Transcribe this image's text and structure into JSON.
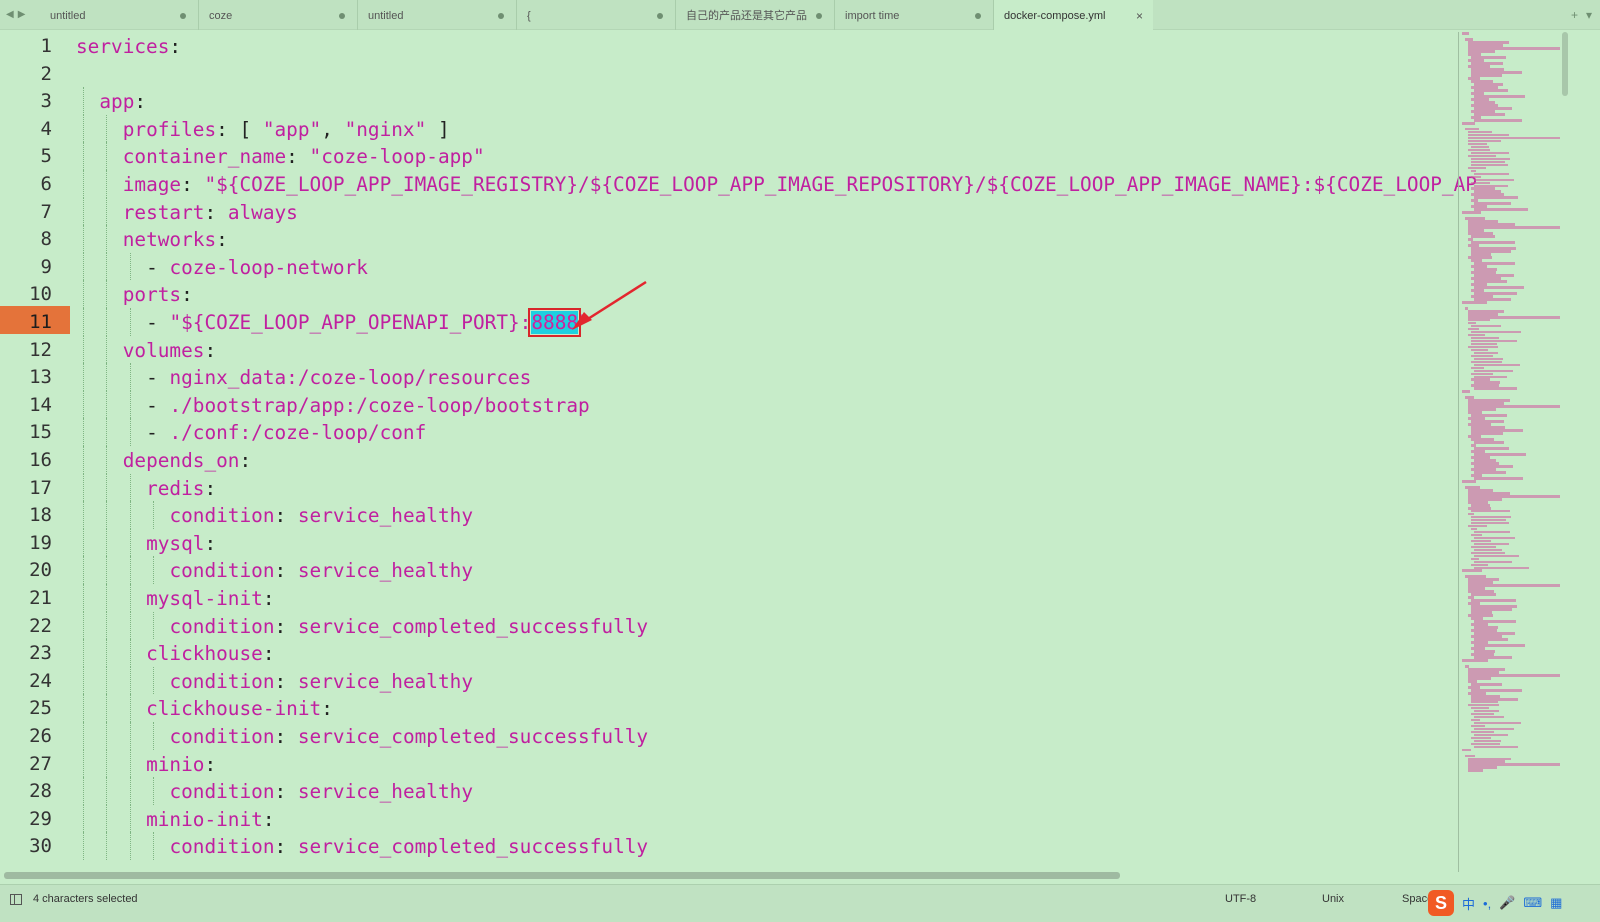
{
  "tabs": [
    {
      "label": "untitled",
      "active": false
    },
    {
      "label": "coze",
      "active": false
    },
    {
      "label": "untitled",
      "active": false
    },
    {
      "label": "{",
      "active": false
    },
    {
      "label": "自己的产品还是其它产品",
      "active": false
    },
    {
      "label": "import time",
      "active": false
    },
    {
      "label": "docker-compose.yml",
      "active": true
    }
  ],
  "tab_nav": {
    "back": "◀",
    "forward": "▶"
  },
  "tab_tools": {
    "new_tab": "+",
    "menu": "▾"
  },
  "active_close": "×",
  "editor": {
    "current_line": 11,
    "lines": [
      {
        "n": "1",
        "indent": 0,
        "parts": [
          {
            "t": "services",
            "c": "k"
          },
          {
            "t": ":",
            "c": "p"
          }
        ]
      },
      {
        "n": "2",
        "indent": 0,
        "parts": []
      },
      {
        "n": "3",
        "indent": 1,
        "parts": [
          {
            "t": "app",
            "c": "k"
          },
          {
            "t": ":",
            "c": "p"
          }
        ]
      },
      {
        "n": "4",
        "indent": 2,
        "parts": [
          {
            "t": "profiles",
            "c": "k"
          },
          {
            "t": ": [ ",
            "c": "p"
          },
          {
            "t": "\"app\"",
            "c": "s"
          },
          {
            "t": ", ",
            "c": "p"
          },
          {
            "t": "\"nginx\"",
            "c": "s"
          },
          {
            "t": " ]",
            "c": "p"
          }
        ]
      },
      {
        "n": "5",
        "indent": 2,
        "parts": [
          {
            "t": "container_name",
            "c": "k"
          },
          {
            "t": ": ",
            "c": "p"
          },
          {
            "t": "\"coze-loop-app\"",
            "c": "s"
          }
        ]
      },
      {
        "n": "6",
        "indent": 2,
        "parts": [
          {
            "t": "image",
            "c": "k"
          },
          {
            "t": ": ",
            "c": "p"
          },
          {
            "t": "\"${COZE_LOOP_APP_IMAGE_REGISTRY}/${COZE_LOOP_APP_IMAGE_REPOSITORY}/${COZE_LOOP_APP_IMAGE_NAME}:${COZE_LOOP_AP",
            "c": "s"
          }
        ]
      },
      {
        "n": "7",
        "indent": 2,
        "parts": [
          {
            "t": "restart",
            "c": "k"
          },
          {
            "t": ": ",
            "c": "p"
          },
          {
            "t": "always",
            "c": "s"
          }
        ]
      },
      {
        "n": "8",
        "indent": 2,
        "parts": [
          {
            "t": "networks",
            "c": "k"
          },
          {
            "t": ":",
            "c": "p"
          }
        ]
      },
      {
        "n": "9",
        "indent": 3,
        "parts": [
          {
            "t": "- ",
            "c": "p"
          },
          {
            "t": "coze-loop-network",
            "c": "s"
          }
        ]
      },
      {
        "n": "10",
        "indent": 2,
        "parts": [
          {
            "t": "ports",
            "c": "k"
          },
          {
            "t": ":",
            "c": "p"
          }
        ]
      },
      {
        "n": "11",
        "indent": 3,
        "parts": [
          {
            "t": "- ",
            "c": "p"
          },
          {
            "t": "\"${COZE_LOOP_APP_OPENAPI_PORT}:",
            "c": "s"
          },
          {
            "t": "8888",
            "c": "sel"
          },
          {
            "t": "\"",
            "c": "s"
          }
        ]
      },
      {
        "n": "12",
        "indent": 2,
        "parts": [
          {
            "t": "volumes",
            "c": "k"
          },
          {
            "t": ":",
            "c": "p"
          }
        ]
      },
      {
        "n": "13",
        "indent": 3,
        "parts": [
          {
            "t": "- ",
            "c": "p"
          },
          {
            "t": "nginx_data:/coze-loop/resources",
            "c": "s"
          }
        ]
      },
      {
        "n": "14",
        "indent": 3,
        "parts": [
          {
            "t": "- ",
            "c": "p"
          },
          {
            "t": "./bootstrap/app:/coze-loop/bootstrap",
            "c": "s"
          }
        ]
      },
      {
        "n": "15",
        "indent": 3,
        "parts": [
          {
            "t": "- ",
            "c": "p"
          },
          {
            "t": "./conf:/coze-loop/conf",
            "c": "s"
          }
        ]
      },
      {
        "n": "16",
        "indent": 2,
        "parts": [
          {
            "t": "depends_on",
            "c": "k"
          },
          {
            "t": ":",
            "c": "p"
          }
        ]
      },
      {
        "n": "17",
        "indent": 3,
        "parts": [
          {
            "t": "redis",
            "c": "k"
          },
          {
            "t": ":",
            "c": "p"
          }
        ]
      },
      {
        "n": "18",
        "indent": 4,
        "parts": [
          {
            "t": "condition",
            "c": "k"
          },
          {
            "t": ": ",
            "c": "p"
          },
          {
            "t": "service_healthy",
            "c": "s"
          }
        ]
      },
      {
        "n": "19",
        "indent": 3,
        "parts": [
          {
            "t": "mysql",
            "c": "k"
          },
          {
            "t": ":",
            "c": "p"
          }
        ]
      },
      {
        "n": "20",
        "indent": 4,
        "parts": [
          {
            "t": "condition",
            "c": "k"
          },
          {
            "t": ": ",
            "c": "p"
          },
          {
            "t": "service_healthy",
            "c": "s"
          }
        ]
      },
      {
        "n": "21",
        "indent": 3,
        "parts": [
          {
            "t": "mysql-init",
            "c": "k"
          },
          {
            "t": ":",
            "c": "p"
          }
        ]
      },
      {
        "n": "22",
        "indent": 4,
        "parts": [
          {
            "t": "condition",
            "c": "k"
          },
          {
            "t": ": ",
            "c": "p"
          },
          {
            "t": "service_completed_successfully",
            "c": "s"
          }
        ]
      },
      {
        "n": "23",
        "indent": 3,
        "parts": [
          {
            "t": "clickhouse",
            "c": "k"
          },
          {
            "t": ":",
            "c": "p"
          }
        ]
      },
      {
        "n": "24",
        "indent": 4,
        "parts": [
          {
            "t": "condition",
            "c": "k"
          },
          {
            "t": ": ",
            "c": "p"
          },
          {
            "t": "service_healthy",
            "c": "s"
          }
        ]
      },
      {
        "n": "25",
        "indent": 3,
        "parts": [
          {
            "t": "clickhouse-init",
            "c": "k"
          },
          {
            "t": ":",
            "c": "p"
          }
        ]
      },
      {
        "n": "26",
        "indent": 4,
        "parts": [
          {
            "t": "condition",
            "c": "k"
          },
          {
            "t": ": ",
            "c": "p"
          },
          {
            "t": "service_completed_successfully",
            "c": "s"
          }
        ]
      },
      {
        "n": "27",
        "indent": 3,
        "parts": [
          {
            "t": "minio",
            "c": "k"
          },
          {
            "t": ":",
            "c": "p"
          }
        ]
      },
      {
        "n": "28",
        "indent": 4,
        "parts": [
          {
            "t": "condition",
            "c": "k"
          },
          {
            "t": ": ",
            "c": "p"
          },
          {
            "t": "service_healthy",
            "c": "s"
          }
        ]
      },
      {
        "n": "29",
        "indent": 3,
        "parts": [
          {
            "t": "minio-init",
            "c": "k"
          },
          {
            "t": ":",
            "c": "p"
          }
        ]
      },
      {
        "n": "30",
        "indent": 4,
        "parts": [
          {
            "t": "condition",
            "c": "k"
          },
          {
            "t": ": ",
            "c": "p"
          },
          {
            "t": "service_completed_successfully",
            "c": "s"
          }
        ]
      }
    ]
  },
  "statusbar": {
    "selection": "4 characters selected",
    "encoding": "UTF-8",
    "line_ending": "Unix",
    "indent": "Space"
  },
  "ime": {
    "logo": "S",
    "lang": "中",
    "punct": "•,",
    "mic": "🎤",
    "keyboard": "⌨",
    "grid": "▦"
  },
  "colors": {
    "background": "#c7ecc9",
    "keyword": "#c020a0",
    "current_line": "#e4733a",
    "selection": "#1ed0e0",
    "annotation": "#d8262b"
  }
}
